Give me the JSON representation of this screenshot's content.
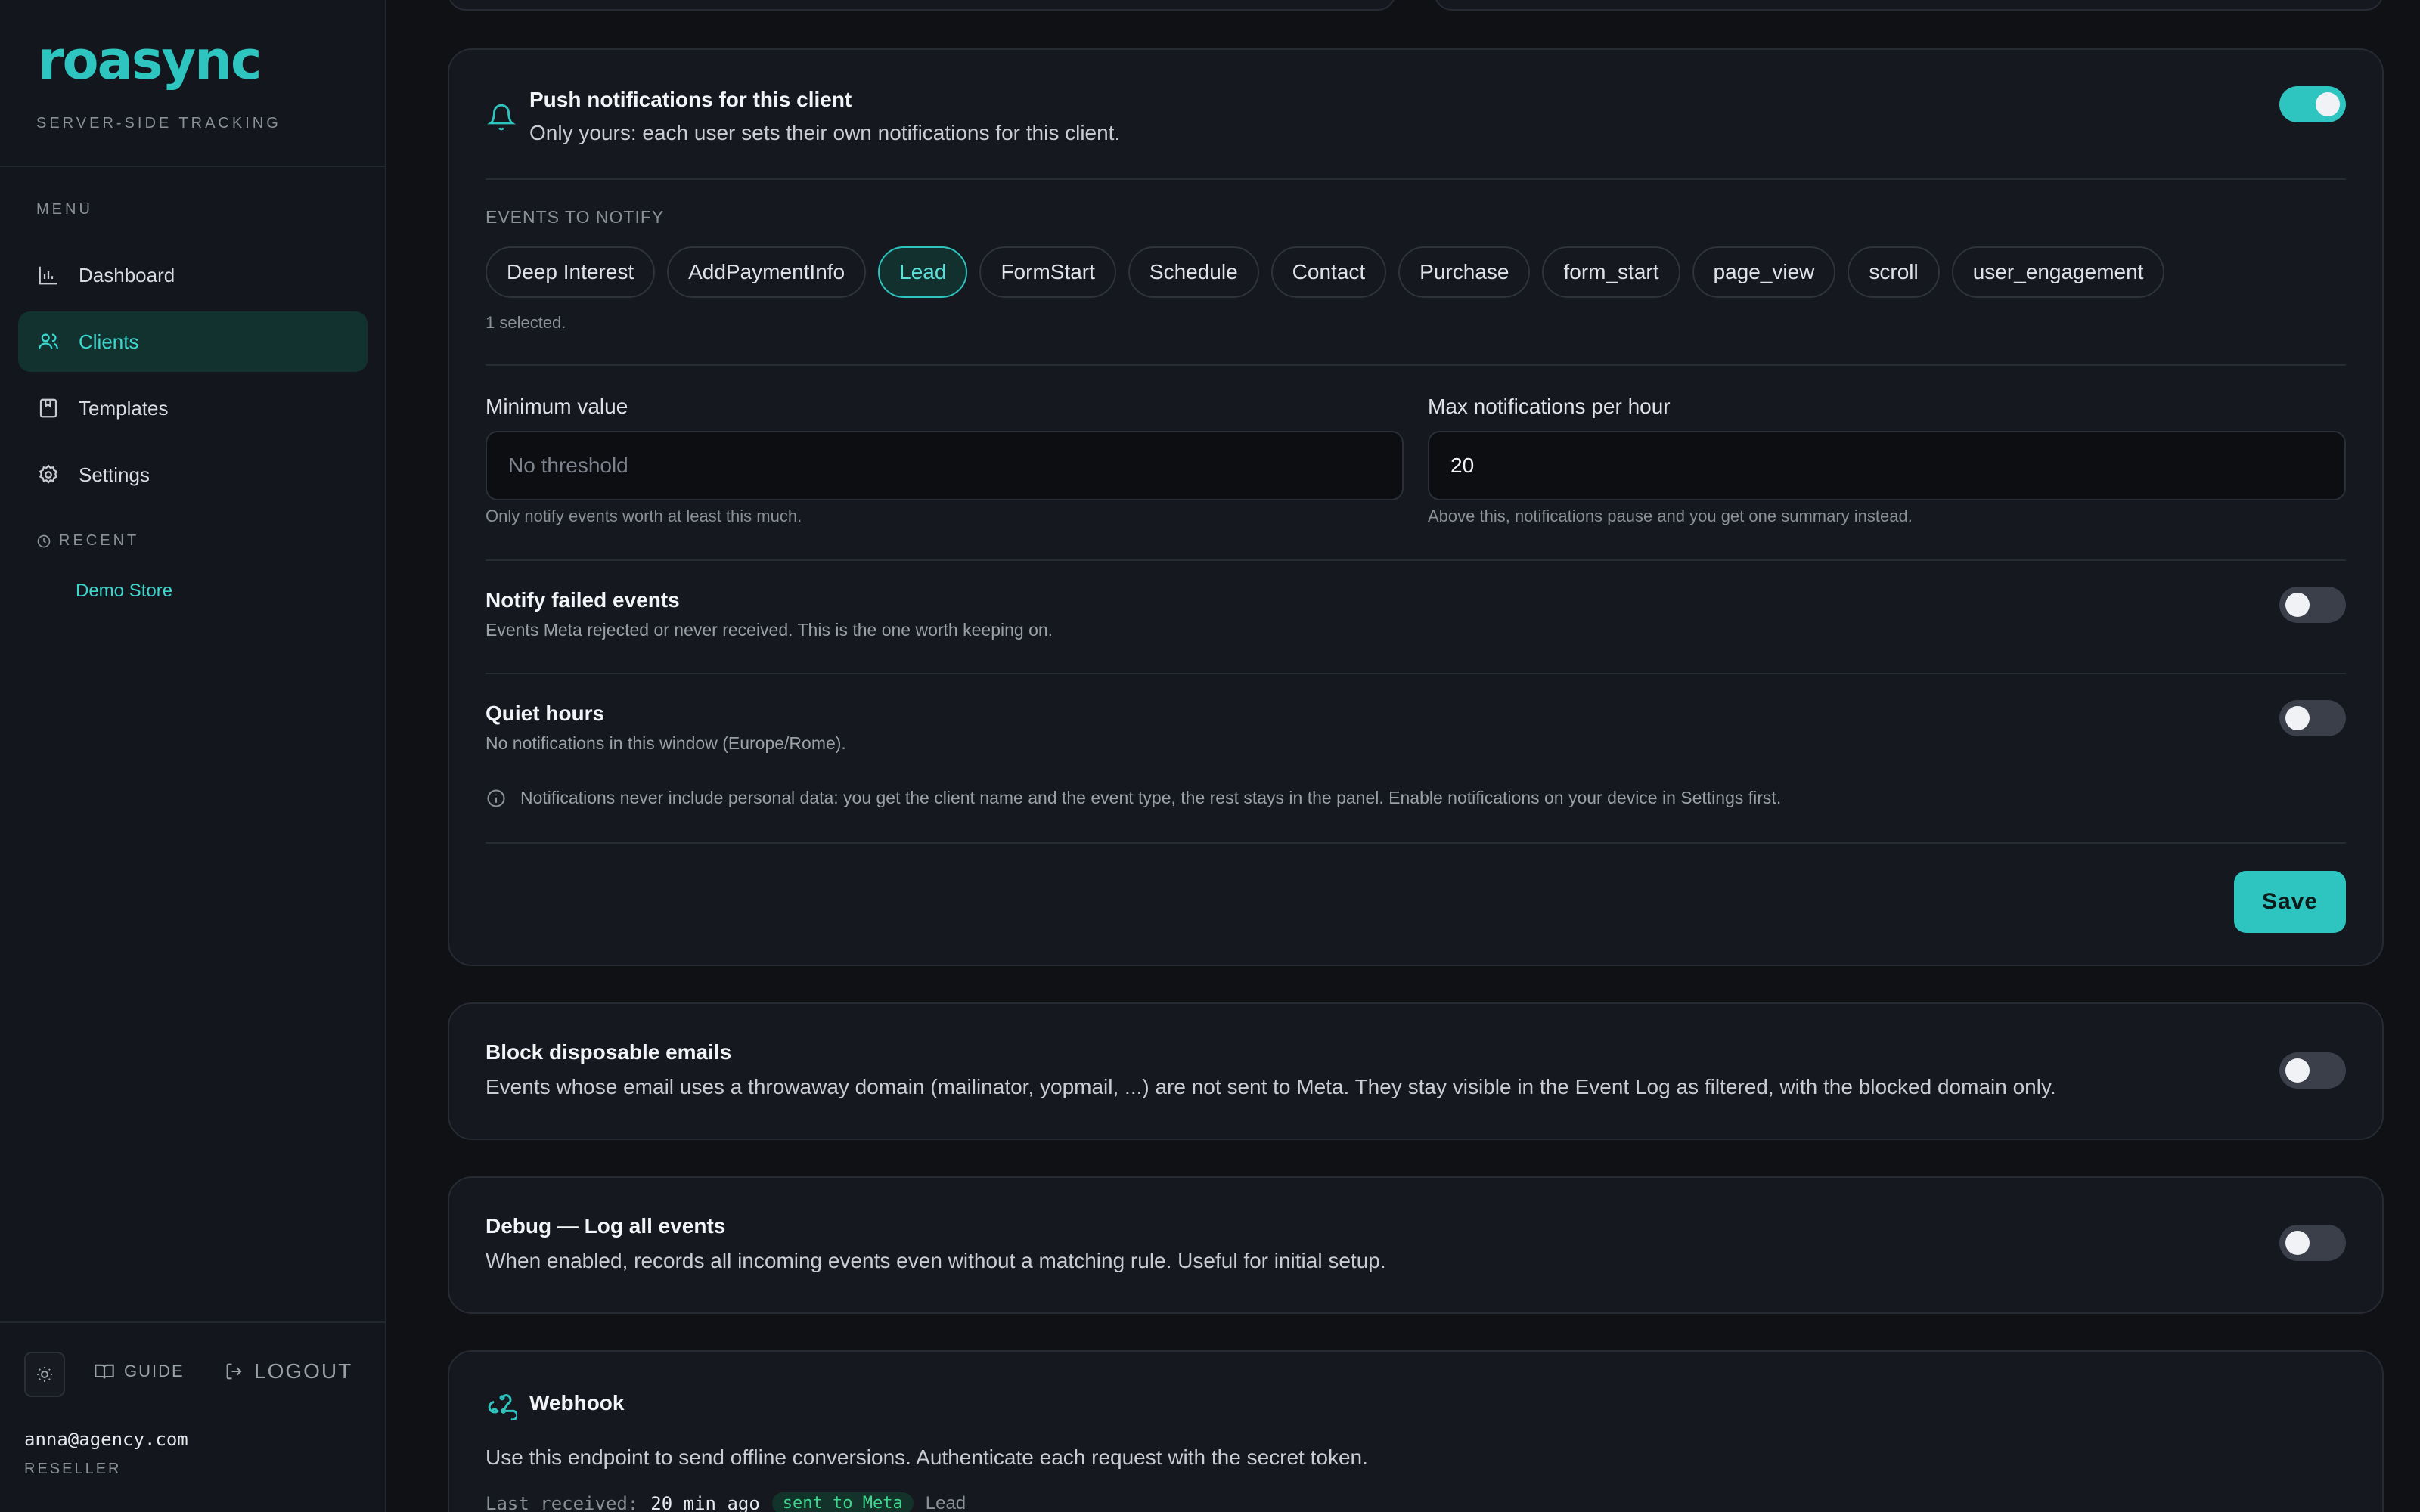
{
  "sidebar": {
    "logo": "roasync",
    "tagline": "SERVER-SIDE TRACKING",
    "menu_label": "MENU",
    "items": [
      {
        "label": "Dashboard",
        "icon": "bar-chart-icon"
      },
      {
        "label": "Clients",
        "icon": "users-icon",
        "active": true
      },
      {
        "label": "Templates",
        "icon": "bookmark-icon"
      },
      {
        "label": "Settings",
        "icon": "gear-icon"
      }
    ],
    "recent_label": "RECENT",
    "recent_items": [
      "Demo Store"
    ],
    "guide_label": "GUIDE",
    "logout_label": "LOGOUT",
    "user_email": "anna@agency.com",
    "user_role": "RESELLER"
  },
  "push": {
    "title": "Push notifications for this client",
    "subtitle": "Only yours: each user sets their own notifications for this client.",
    "enabled": true,
    "events_label": "EVENTS TO NOTIFY",
    "events": [
      "Deep Interest",
      "AddPaymentInfo",
      "Lead",
      "FormStart",
      "Schedule",
      "Contact",
      "Purchase",
      "form_start",
      "page_view",
      "scroll",
      "user_engagement"
    ],
    "selected_event": "Lead",
    "selected_count_text": "1 selected.",
    "min_value": {
      "label": "Minimum value",
      "placeholder": "No threshold",
      "value": "",
      "help": "Only notify events worth at least this much."
    },
    "max_per_hour": {
      "label": "Max notifications per hour",
      "value": "20",
      "help": "Above this, notifications pause and you get one summary instead."
    },
    "failed": {
      "title": "Notify failed events",
      "subtitle": "Events Meta rejected or never received. This is the one worth keeping on.",
      "enabled": false
    },
    "quiet": {
      "title": "Quiet hours",
      "subtitle": "No notifications in this window (Europe/Rome).",
      "enabled": false
    },
    "info_note": "Notifications never include personal data: you get the client name and the event type, the rest stays in the panel. Enable notifications on your device in Settings first.",
    "save_label": "Save"
  },
  "block_disposable": {
    "title": "Block disposable emails",
    "subtitle": "Events whose email uses a throwaway domain (mailinator, yopmail, ...) are not sent to Meta. They stay visible in the Event Log as filtered, with the blocked domain only.",
    "enabled": false
  },
  "debug": {
    "title": "Debug — Log all events",
    "subtitle": "When enabled, records all incoming events even without a matching rule. Useful for initial setup.",
    "enabled": false
  },
  "webhook": {
    "title": "Webhook",
    "subtitle": "Use this endpoint to send offline conversions. Authenticate each request with the secret token.",
    "last_received_label": "Last received:",
    "last_received_value": "20 min ago",
    "status_badge": "sent to Meta",
    "event": "Lead"
  },
  "colors": {
    "accent": "#2ec4bf",
    "background": "#0f1115",
    "card": "#15181e",
    "sidebar": "#13161c"
  }
}
